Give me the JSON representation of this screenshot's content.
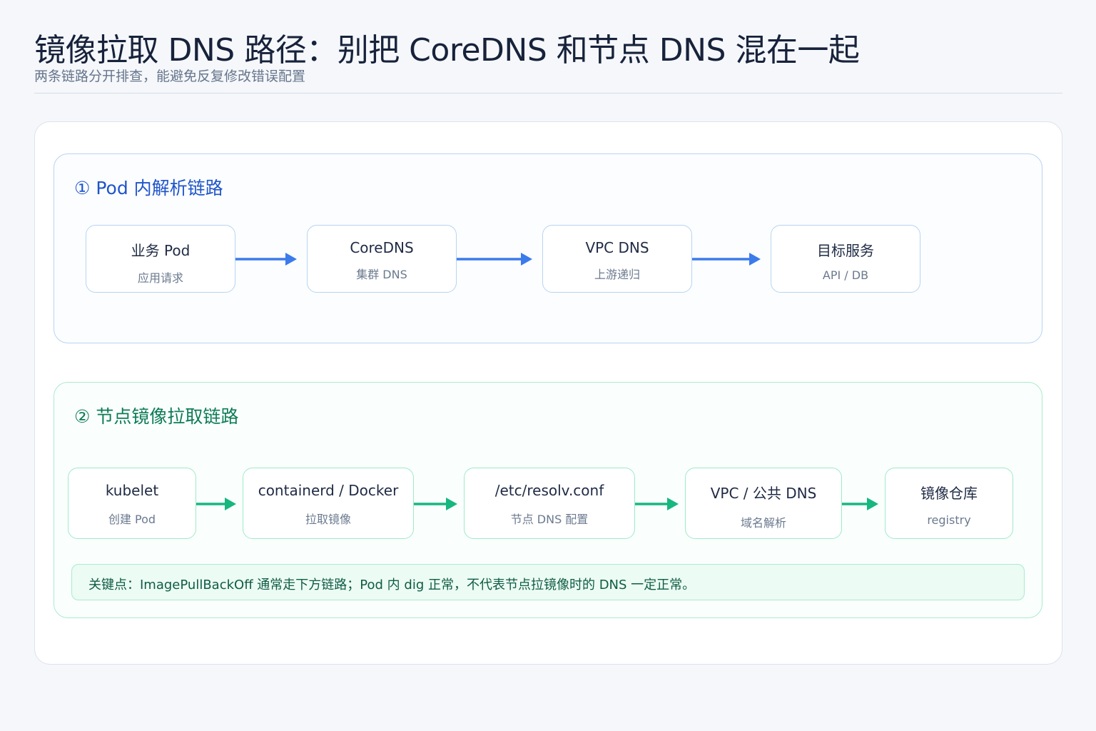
{
  "header": {
    "title": "镜像拉取 DNS 路径：别把 CoreDNS 和节点 DNS 混在一起",
    "subtitle": "两条链路分开排查，能避免反复修改错误配置"
  },
  "colors": {
    "blue_accent": "#3b7bea",
    "green_accent": "#17b77f",
    "blue_title": "#1f55c9",
    "green_title": "#0e7b55"
  },
  "section_a": {
    "title": "① Pod 内解析链路",
    "nodes": [
      {
        "label": "业务 Pod",
        "sub": "应用请求"
      },
      {
        "label": "CoreDNS",
        "sub": "集群 DNS"
      },
      {
        "label": "VPC DNS",
        "sub": "上游递归"
      },
      {
        "label": "目标服务",
        "sub": "API / DB"
      }
    ]
  },
  "section_b": {
    "title": "② 节点镜像拉取链路",
    "nodes": [
      {
        "label": "kubelet",
        "sub": "创建 Pod"
      },
      {
        "label": "containerd / Docker",
        "sub": "拉取镜像"
      },
      {
        "label": "/etc/resolv.conf",
        "sub": "节点 DNS 配置"
      },
      {
        "label": "VPC / 公共 DNS",
        "sub": "域名解析"
      },
      {
        "label": "镜像仓库",
        "sub": "registry"
      }
    ],
    "note": "关键点：ImagePullBackOff 通常走下方链路；Pod 内 dig 正常，不代表节点拉镜像时的 DNS 一定正常。"
  }
}
